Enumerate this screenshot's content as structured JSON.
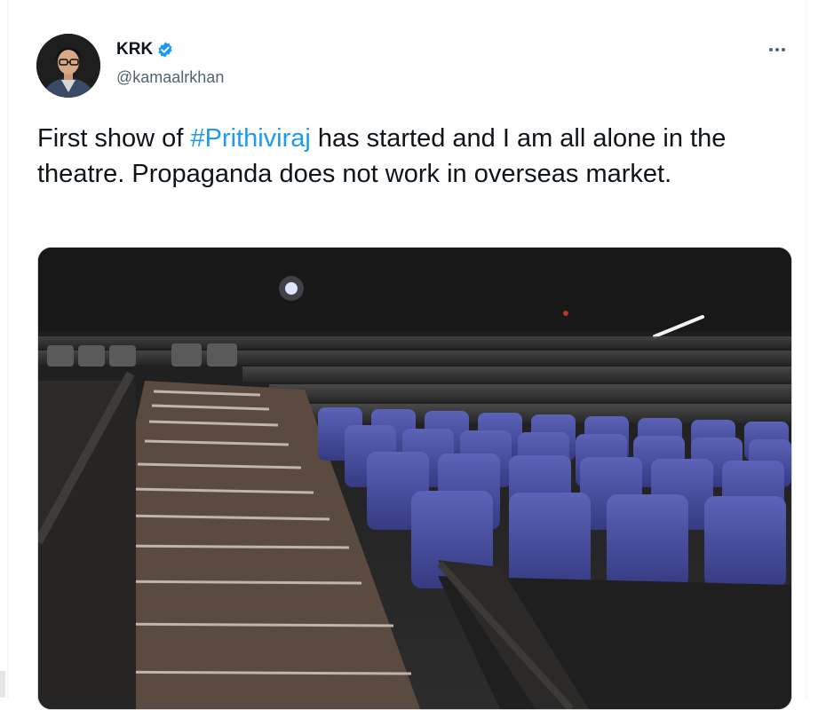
{
  "author": {
    "display_name": "KRK",
    "handle": "@kamaalrkhan",
    "verified_icon": "verified-badge-icon",
    "badge_color": "#1d9bf0"
  },
  "tweet": {
    "text_part1": "First show of ",
    "hashtag": "#Prithiviraj",
    "text_part2": " has started and I am all alone in the theatre. Propaganda does not work in overseas market."
  },
  "menu_icon": "more-options-icon",
  "media": {
    "icon": "photo-cinema-hall"
  },
  "colors": {
    "text": "#0f1419",
    "secondary": "#536471",
    "link": "#1d9bf0"
  }
}
